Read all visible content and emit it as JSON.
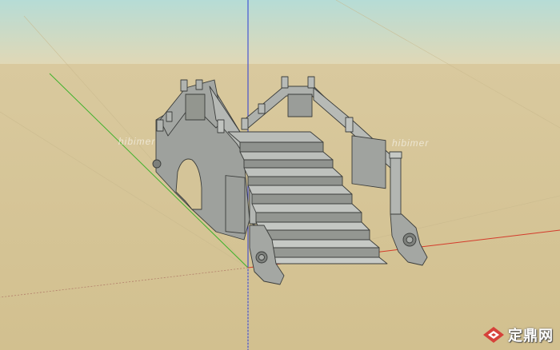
{
  "viewport": {
    "sky_top": "#b6dcd6",
    "sky_bottom": "#d9d6b8",
    "ground": "#d6c59a",
    "axis_red": "#d43a2a",
    "axis_green": "#3fb22c",
    "axis_blue": "#2a3ad4"
  },
  "model": {
    "stone_color": "#a8aba7",
    "stone_dark": "#7e817d",
    "stone_light": "#c4c6c2"
  },
  "watermarks": [
    "hibimer",
    "hibimer"
  ],
  "logo": {
    "text": "定鼎网",
    "icon": "dingding-logo-icon",
    "color": "#d6423a"
  }
}
